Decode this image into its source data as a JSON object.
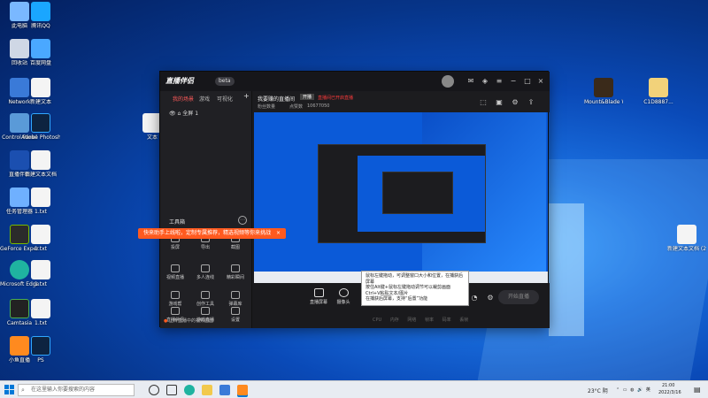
{
  "desktop": {
    "icons": [
      {
        "label": "此电脑",
        "icon": "computer-icon"
      },
      {
        "label": "腾讯QQ",
        "icon": "qq-icon"
      },
      {
        "label": "回收站",
        "icon": "recycle-bin-icon"
      },
      {
        "label": "百度网盘",
        "icon": "baidu-netdisk-icon"
      },
      {
        "label": "Network",
        "icon": "network-icon"
      },
      {
        "label": "新建文本",
        "icon": "text-file-icon"
      },
      {
        "label": "Control Panel",
        "icon": "control-panel-icon"
      },
      {
        "label": "Adobe Photoshop",
        "icon": "photoshop-icon"
      },
      {
        "label": "直播伴侣",
        "icon": "app-icon"
      },
      {
        "label": "新建文本文档",
        "icon": "text-file-icon"
      },
      {
        "label": "任务管理器",
        "icon": "task-manager-icon"
      },
      {
        "label": "1.txt",
        "icon": "text-file-icon"
      },
      {
        "label": "GeForce Experience",
        "icon": "nvidia-icon"
      },
      {
        "label": "1.txt",
        "icon": "text-file-icon"
      },
      {
        "label": "Microsoft Edge",
        "icon": "edge-icon"
      },
      {
        "label": "1.txt",
        "icon": "text-file-icon"
      },
      {
        "label": "Camtasia",
        "icon": "camtasia-icon"
      },
      {
        "label": "1.txt",
        "icon": "text-file-icon"
      },
      {
        "label": "小鱼直播",
        "icon": "app-icon"
      },
      {
        "label": "PS",
        "icon": "photoshop-icon"
      },
      {
        "label": "文本",
        "icon": "text-file-icon"
      },
      {
        "label": "Mount&Blade Warband",
        "icon": "game-icon"
      },
      {
        "label": "C1D8887...",
        "icon": "file-icon"
      },
      {
        "label": "新建文本文档 (2)",
        "icon": "text-file-icon"
      }
    ]
  },
  "app": {
    "logo": "直播伴侣",
    "badge": "beta",
    "left_tabs": [
      "我的场景",
      "游戏",
      "可视化"
    ],
    "scene_name": "全屏 1",
    "tools_title": "工具箱",
    "tools": [
      "投屏",
      "导出",
      "截图",
      "视频直播",
      "多人连线",
      "精彩瞬间",
      "游戏帮",
      "创作工具",
      "弹幕库",
      "直播伴侣",
      "游戏直播",
      "设置"
    ],
    "left_footer": "上传直播中的视频画面",
    "header_title": "我要赚的直播间",
    "header_tag": "开播",
    "header_warning": "直播间已开启直播",
    "header_sub1": "粉丝数量",
    "header_sub2": "点赞数",
    "header_sub3": "10677050",
    "bottom_buttons": [
      "直播屏幕",
      "摄像头",
      "插件",
      "文字"
    ],
    "start_btn": "开始直播",
    "status": [
      "CPU",
      "内存",
      "网络",
      "帧率",
      "码率",
      "丢帧"
    ]
  },
  "banner": "快来助手上线啦，定制专属推荐，精选视频等你来挑战",
  "tooltip": {
    "lines": [
      "鼠标左键拖动，可调整窗口大小和位置，在捕获后屏幕",
      "按住Alt键+鼠标左键拖动调节可以裁剪画面",
      "Ctrl+V粘贴文本/图片",
      "在捕获后屏幕，支持“后置”功能"
    ]
  },
  "taskbar": {
    "search_placeholder": "在这里输入你要搜索的内容",
    "weather": "23°C 阴",
    "time": "21:00",
    "date": "2022/3/16"
  }
}
